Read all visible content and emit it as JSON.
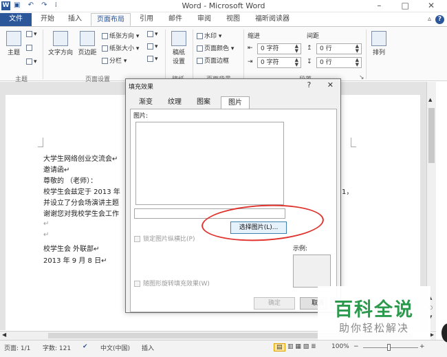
{
  "window": {
    "title": "Word - Microsoft Word",
    "min": "–",
    "max": "□",
    "close": "✕"
  },
  "tabs": [
    "文件",
    "开始",
    "插入",
    "页面布局",
    "引用",
    "邮件",
    "审阅",
    "视图",
    "福昕阅读器"
  ],
  "ribbon": {
    "theme_group": "主题",
    "theme_btn": "主题",
    "text_dir": "文字方向",
    "margins": "页边距",
    "orientation": "纸张方向",
    "size": "纸张大小",
    "columns": "分栏",
    "page_setup_group": "页面设置",
    "draft": "稿纸\n设置",
    "draft_group": "稿纸",
    "watermark": "水印",
    "page_color": "页面颜色",
    "page_border": "页面边框",
    "page_bg_group": "页面背景",
    "indent_label": "缩进",
    "spacing_label": "间距",
    "indent_left": "0 字符",
    "indent_right": "0 字符",
    "space_before": "0 行",
    "space_after": "0 行",
    "paragraph_group": "段落",
    "arrange": "排列"
  },
  "document": {
    "lines": [
      "大学生网络创业交流会↵",
      "邀请函↵",
      "尊敬的          （老师）：",
      "校学生会兹定于 2013 年",
      "并设立了分会场演讲主题",
      "谢谢您对我校学生会工作",
      "↵",
      "↵",
      "校学生会 外联部↵",
      "2013 年 9 月 8 日↵"
    ],
    "right_fragment": "1，"
  },
  "dialog": {
    "title": "填充效果",
    "help": "?",
    "close": "✕",
    "tabs": [
      "渐变",
      "纹理",
      "图案",
      "图片"
    ],
    "picture_label": "图片:",
    "select_button": "选择图片(L)...",
    "lock_ratio": "锁定图片纵横比(P)",
    "rotate_with_shape": "随图形旋转填充效果(W)",
    "sample_label": "示例:",
    "ok": "确定",
    "cancel": "取消"
  },
  "status": {
    "page": "页面: 1/1",
    "words": "字数: 121",
    "lang": "中文(中国)",
    "mode": "插入",
    "zoom": "100%",
    "zoom_minus": "−",
    "zoom_plus": "+"
  },
  "watermark": {
    "line1": "百科全说",
    "line2": "助你轻松解决"
  },
  "colors": {
    "accent": "#2b579a",
    "annotation": "#e0332e",
    "brand_green": "#2c9a4c"
  }
}
